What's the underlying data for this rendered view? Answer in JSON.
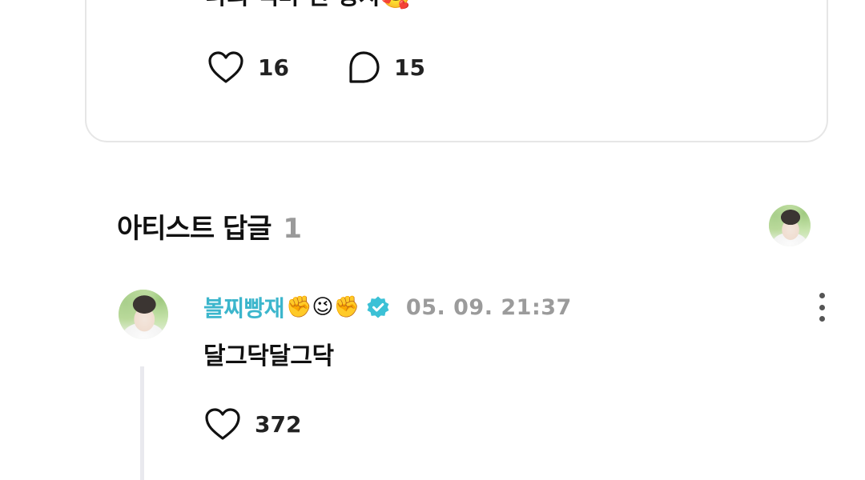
{
  "post": {
    "text": "나의 백마 탄 왕자🥰",
    "like_count": "16",
    "comment_count": "15"
  },
  "artist_replies": {
    "title": "아티스트 답글",
    "count": "1"
  },
  "reply": {
    "author": "볼찌빵재",
    "author_emojis": "✊😉✊",
    "timestamp": "05. 09. 21:37",
    "text": "달그닥달그닥",
    "like_count": "372"
  },
  "icons": {
    "like": "heart-outline-icon",
    "comment": "speech-bubble-icon",
    "verified": "verified-badge-icon",
    "more": "more-vertical-icon"
  },
  "colors": {
    "author_name": "#3cb6cc",
    "verified_badge": "#3cc1d6",
    "timestamp": "#9b9b9b",
    "card_border": "#e6e6e6"
  }
}
